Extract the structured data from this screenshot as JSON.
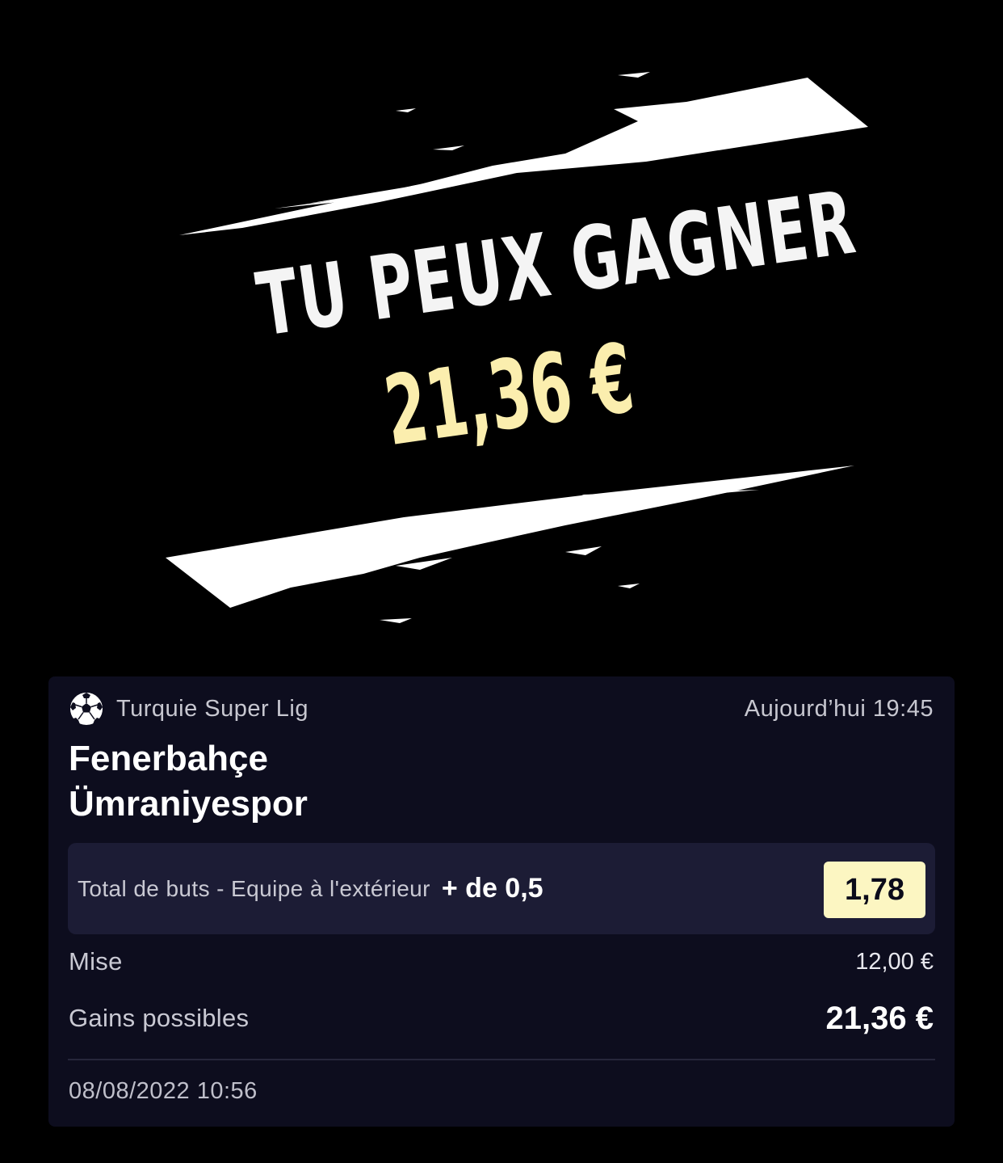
{
  "promo": {
    "headline": "TU PEUX GAGNER",
    "amount": "21,36 €",
    "colors": {
      "headline": "#f4f4f4",
      "amount": "#fbeeae",
      "background": "#000000"
    }
  },
  "bet_card": {
    "league_icon": "soccer-ball-icon",
    "league": "Turquie Super Lig",
    "match_time": "Aujourd’hui 19:45",
    "home_team": "Fenerbahçe",
    "away_team": "Ümraniyespor",
    "market": "Total de buts - Equipe à l'extérieur",
    "pick": "+ de 0,5",
    "odds": "1,78",
    "stake_label": "Mise",
    "stake_value": "12,00 €",
    "gains_label": "Gains possibles",
    "gains_value": "21,36 €",
    "placed_at": "08/08/2022 10:56",
    "colors": {
      "card_bg": "#0d0d1e",
      "selection_bg": "#1c1c35",
      "odds_bg": "#fcf6c2"
    }
  }
}
